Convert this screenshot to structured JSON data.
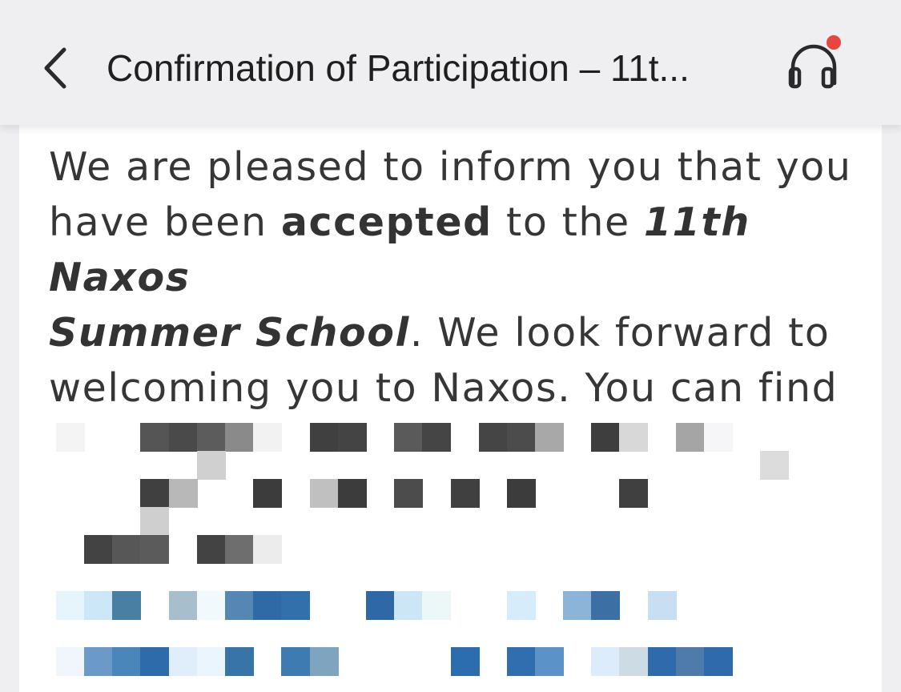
{
  "header": {
    "title": "Confirmation of Participation – 11t...",
    "back_icon": "chevron-left-icon",
    "listen_icon": "headphones-icon",
    "badge_color": "#e8463c"
  },
  "message": {
    "intro": "We are pleased to inform you that you have been ",
    "status": "accepted",
    "mid": " to the ",
    "event_line1": "11th Naxos",
    "event_line2": "Summer School",
    "rest_line1": ". We look forward to",
    "rest_line2": "welcoming you to Naxos. You can find"
  },
  "redacted": {
    "note": "",
    "text_color": "#444444",
    "link_color": "#3a72b0"
  }
}
